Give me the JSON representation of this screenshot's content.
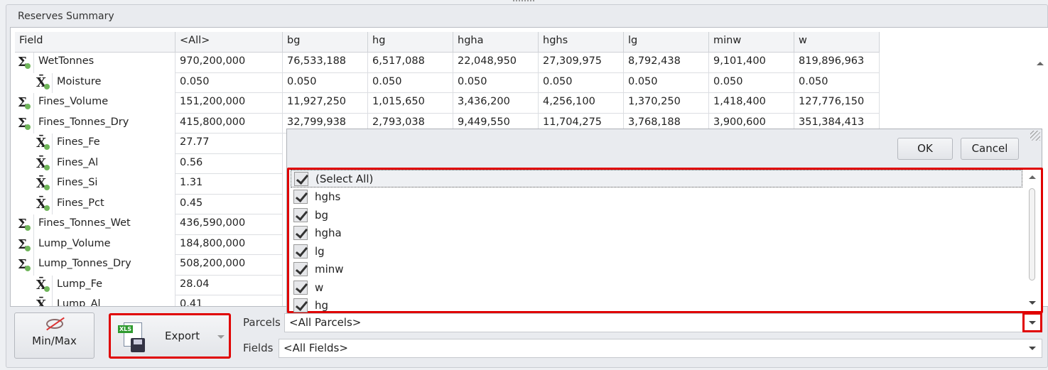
{
  "panel": {
    "title": "Reserves Summary"
  },
  "grid": {
    "columns": [
      "Field",
      "<All>",
      "bg",
      "hg",
      "hgha",
      "hghs",
      "lg",
      "minw",
      "w"
    ],
    "rows": [
      {
        "type": "sum",
        "field": "WetTonnes",
        "values": [
          "970,200,000",
          "76,533,188",
          "6,517,088",
          "22,048,950",
          "27,309,975",
          "8,792,438",
          "9,101,400",
          "819,896,963"
        ]
      },
      {
        "type": "avg",
        "field": "Moisture",
        "values": [
          "0.050",
          "0.050",
          "0.050",
          "0.050",
          "0.050",
          "0.050",
          "0.050",
          "0.050"
        ]
      },
      {
        "type": "sum",
        "field": "Fines_Volume",
        "values": [
          "151,200,000",
          "11,927,250",
          "1,015,650",
          "3,436,200",
          "4,256,100",
          "1,370,250",
          "1,418,400",
          "127,776,150"
        ]
      },
      {
        "type": "sum",
        "field": "Fines_Tonnes_Dry",
        "values": [
          "415,800,000",
          "32,799,938",
          "2,793,038",
          "9,449,550",
          "11,704,275",
          "3,768,188",
          "3,900,600",
          "351,384,413"
        ]
      },
      {
        "type": "avg",
        "field": "Fines_Fe",
        "values": [
          "27.77"
        ]
      },
      {
        "type": "avg",
        "field": "Fines_Al",
        "values": [
          "0.56"
        ]
      },
      {
        "type": "avg",
        "field": "Fines_Si",
        "values": [
          "1.31"
        ]
      },
      {
        "type": "avg",
        "field": "Fines_Pct",
        "values": [
          "0.45"
        ]
      },
      {
        "type": "sum",
        "field": "Fines_Tonnes_Wet",
        "values": [
          "436,590,000"
        ]
      },
      {
        "type": "sum",
        "field": "Lump_Volume",
        "values": [
          "184,800,000"
        ]
      },
      {
        "type": "sum",
        "field": "Lump_Tonnes_Dry",
        "values": [
          "508,200,000"
        ]
      },
      {
        "type": "avg",
        "field": "Lump_Fe",
        "values": [
          "28.04"
        ]
      },
      {
        "type": "avg",
        "field": "Lump_Al",
        "values": [
          "0.41"
        ]
      }
    ]
  },
  "popup": {
    "ok_label": "OK",
    "cancel_label": "Cancel",
    "items": [
      {
        "label": "(Select All)",
        "checked": true
      },
      {
        "label": "hghs",
        "checked": true
      },
      {
        "label": "bg",
        "checked": true
      },
      {
        "label": "hgha",
        "checked": true
      },
      {
        "label": "lg",
        "checked": true
      },
      {
        "label": "minw",
        "checked": true
      },
      {
        "label": "w",
        "checked": true
      },
      {
        "label": "hg",
        "checked": true
      }
    ]
  },
  "toolbar": {
    "minmax_label": "Min/Max",
    "export_label": "Export",
    "xls_badge": "XLS"
  },
  "filters": {
    "parcels_label": "Parcels",
    "parcels_value": "<All Parcels>",
    "fields_label": "Fields",
    "fields_value": "<All Fields>"
  }
}
